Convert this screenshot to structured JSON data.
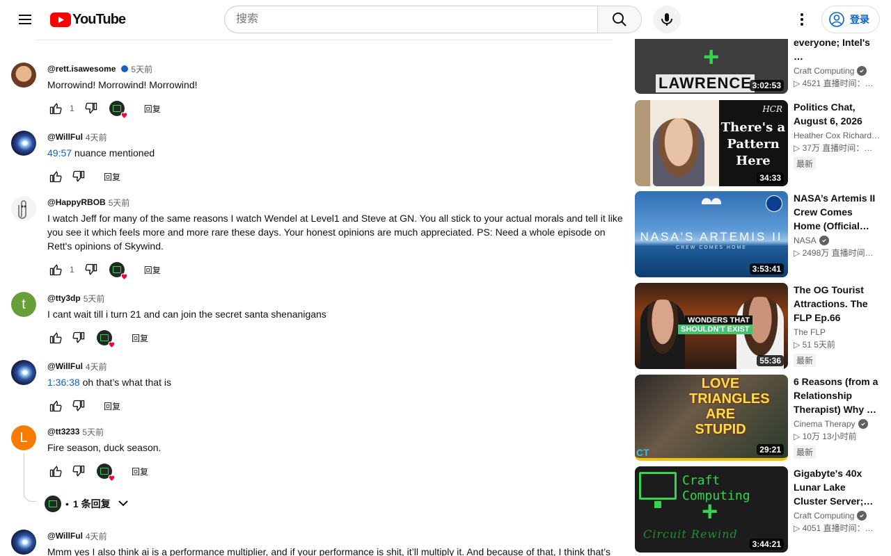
{
  "header": {
    "logo_text": "YouTube",
    "search_placeholder": "搜索",
    "signin_label": "登录"
  },
  "comments": [
    {
      "author": "@rett.isawesome",
      "verified": true,
      "time": "5天前",
      "timestamp": "",
      "text": "Morrowind! Morrowind! Morrowind!",
      "likes": "1",
      "hearted": true,
      "reply_label": "回复"
    },
    {
      "author": "@WillFul",
      "verified": false,
      "time": "4天前",
      "timestamp": "49:57",
      "text": " nuance mentioned",
      "likes": "",
      "hearted": false,
      "reply_label": "回复"
    },
    {
      "author": "@HappyRBOB",
      "verified": false,
      "time": "5天前",
      "timestamp": "",
      "text": "I watch Jeff for many of the same reasons I watch Wendel at Level1 and Steve at GN. You all stick to your actual morals and tell it like you see it which feels more and more rare these days. Your honest opinions are much appreciated. PS: Need a whole episode on Rett's opinions of Skywind.",
      "likes": "1",
      "hearted": true,
      "reply_label": "回复"
    },
    {
      "author": "@tty3dp",
      "verified": false,
      "time": "5天前",
      "timestamp": "",
      "text": "I cant wait till i turn 21 and can join the secret santa shenanigans",
      "likes": "",
      "hearted": true,
      "reply_label": "回复",
      "avatar_letter": "t"
    },
    {
      "author": "@WillFul",
      "verified": false,
      "time": "4天前",
      "timestamp": "1:36:38",
      "text": " oh that’s what that is",
      "likes": "",
      "hearted": false,
      "reply_label": "回复"
    },
    {
      "author": "@tt3233",
      "verified": false,
      "time": "5天前",
      "timestamp": "",
      "text": "Fire season, duck season.",
      "likes": "",
      "hearted": true,
      "reply_label": "回复",
      "avatar_letter": "L"
    },
    {
      "author": "@WillFul",
      "verified": false,
      "time": "4天前",
      "timestamp": "",
      "text": "Mmm yes I also think ai is a performance multiplier, and if your performance is shit, it’ll multiply it. And because of that, I think that’s",
      "likes": "",
      "hearted": false,
      "reply_label": ""
    }
  ],
  "replies_toggle": {
    "separator": "•",
    "label": "1 条回复"
  },
  "sidebar": [
    {
      "title": "everyone; Intel's …",
      "channel": "Craft Computing",
      "verified": true,
      "stats": "▷ 4521   直播时间：…",
      "badge": "",
      "duration": "3:02:53",
      "thumb_text": "LAWRENCE"
    },
    {
      "title": "Politics Chat, August 6, 2026",
      "channel": "Heather Cox Richard…",
      "verified": false,
      "stats": "▷ 37万   直播时间：…",
      "badge": "最新",
      "duration": "34:33",
      "thumb_text": "There's a Pattern Here",
      "thumb_logo": "HCR"
    },
    {
      "title": "NASA’s Artemis II Crew Comes Home (Official Broadcast)",
      "channel": "NASA",
      "verified": true,
      "stats": "▷ 2498万   直播时间…",
      "badge": "",
      "duration": "3:53:41",
      "thumb_text": "NASA'S ARTEMIS II",
      "thumb_sub": "CREW COMES HOME"
    },
    {
      "title": "The OG Tourist Attractions. The FLP Ep.66",
      "channel": "The FLP",
      "verified": false,
      "stats": "▷ 51   5天前",
      "badge": "最新",
      "duration": "55:36",
      "thumb_text": "WONDERS THAT",
      "thumb_sub": "SHOULDN'T EXIST"
    },
    {
      "title": "6 Reasons (from a Relationship Therapist) Why …",
      "channel": "Cinema Therapy",
      "verified": true,
      "stats": "▷ 10万   13小时前",
      "badge": "最新",
      "duration": "29:21",
      "thumb_text": "LOVE TRIANGLES ARE STUPID",
      "thumb_logo": "CT"
    },
    {
      "title": "Gigabyte's 40x Lunar Lake Cluster Server; Personal …",
      "channel": "Craft Computing",
      "verified": true,
      "stats": "▷ 4051   直播时间：…",
      "badge": "",
      "duration": "3:44:21",
      "thumb_text": "Craft",
      "thumb_text2": "Computing",
      "thumb_sub": "Circuit Rewind"
    }
  ],
  "colors": {
    "accent_link": "#065fd4",
    "brand_red": "#ff0000",
    "heart": "#ff0033"
  }
}
